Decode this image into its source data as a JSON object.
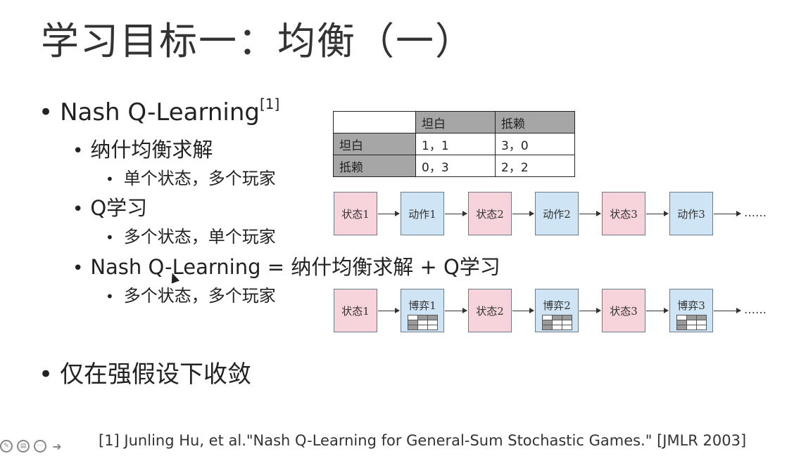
{
  "title": "学习目标一：均衡（一）",
  "bullets": {
    "nash": "Nash Q-Learning",
    "nash_sup": "[1]",
    "nash_solve": "纳什均衡求解",
    "single_state": "单个状态，多个玩家",
    "qlearning": "Q学习",
    "multi_state_single": "多个状态，单个玩家",
    "combo": "Nash Q-Learning = 纳什均衡求解 + Q学习",
    "multi_multi": "多个状态，多个玩家",
    "converge": "仅在强假设下收敛"
  },
  "payoff_table": {
    "col_headers": [
      "",
      "坦白",
      "抵赖"
    ],
    "rows": [
      {
        "label": "坦白",
        "cells": [
          "1，1",
          "3，0"
        ]
      },
      {
        "label": "抵赖",
        "cells": [
          "0，3",
          "2，2"
        ]
      }
    ]
  },
  "chain1": [
    "状态1",
    "动作1",
    "状态2",
    "动作2",
    "状态3",
    "动作3"
  ],
  "chain2": [
    "状态1",
    "博弈1",
    "状态2",
    "博弈2",
    "状态3",
    "博弈3"
  ],
  "ellipsis": "……",
  "reference": "[1] Junling Hu, et al.\"Nash Q-Learning for General-Sum Stochastic Games.\"    [JMLR 2003]",
  "colors": {
    "state_fill": "#f7d3dc",
    "action_fill": "#cfe4f4",
    "header_fill": "#a6a6a6"
  },
  "icons": [
    "pen-icon",
    "slide-icon",
    "more-icon",
    "next-arrow-icon"
  ]
}
